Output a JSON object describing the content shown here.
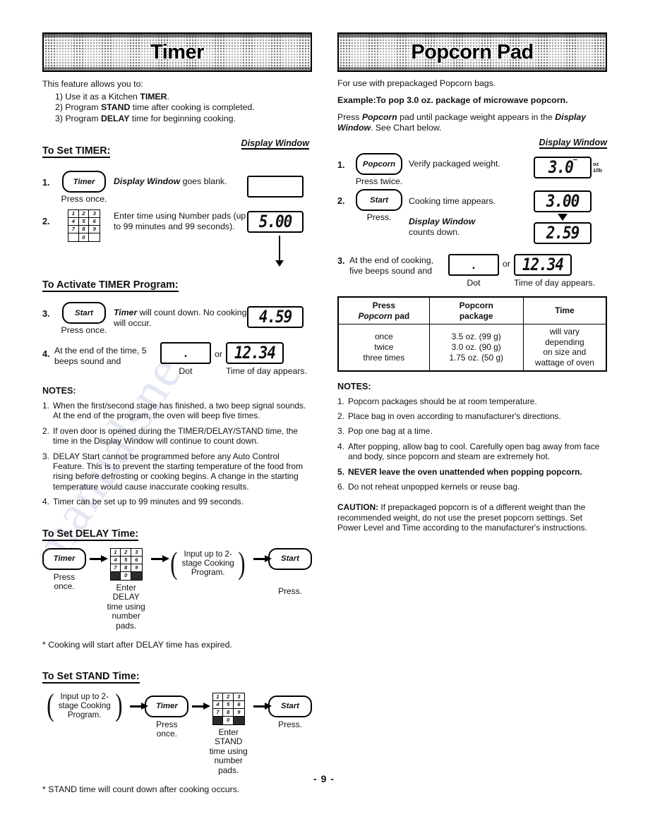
{
  "page": {
    "number": "- 9 -",
    "watermark": "manualsnet"
  },
  "left": {
    "banner_title": "Timer",
    "intro": "This feature allows you to:",
    "feature_list": [
      {
        "num": "1)",
        "pre": "Use it as a Kitchen ",
        "bold": "TIMER",
        "post": "."
      },
      {
        "num": "2)",
        "pre": "Program ",
        "bold": "STAND",
        "post": " time after cooking is completed."
      },
      {
        "num": "3)",
        "pre": "Program ",
        "bold": "DELAY",
        "post": " time for beginning cooking."
      }
    ],
    "section_set_timer": "To Set TIMER:",
    "display_window_label": "Display Window",
    "step1": {
      "num": "1.",
      "key_label": "Timer",
      "caption": "Press once.",
      "text_bold": "Display Window",
      "text_rest": " goes blank.",
      "lcd": ""
    },
    "step2": {
      "num": "2.",
      "keypad": [
        "1",
        "2",
        "3",
        "4",
        "5",
        "6",
        "7",
        "8",
        "9",
        "",
        "0",
        ""
      ],
      "text": "Enter time using Number pads (up to 99 minutes and 99 seconds).",
      "lcd": "5.00"
    },
    "section_activate": "To Activate TIMER Program:",
    "step3": {
      "num": "3.",
      "key_label": "Start",
      "caption": "Press once.",
      "text_bold": "Timer",
      "text_rest": " will count down. No cooking will occur.",
      "lcd": "4.59"
    },
    "step4": {
      "num": "4.",
      "text": "At the end of the time, 5 beeps sound and",
      "dot_caption": "Dot",
      "or": "or",
      "lcd": "12.34",
      "time_caption": "Time of day appears."
    },
    "notes_heading": "NOTES:",
    "notes": [
      {
        "n": "1.",
        "t": "When the first/second stage has finished, a two beep signal sounds.  At the end of the program, the oven will beep five times."
      },
      {
        "n": "2.",
        "t": "If oven door is opened during the TIMER/DELAY/STAND time, the time in the Display Window will continue to count down."
      },
      {
        "n": "3.",
        "t": "DELAY Start cannot be programmed before any Auto Control Feature.  This is to prevent the starting temperature of the food from rising before defrosting or cooking begins.  A change in the starting temperature would cause inaccurate cooking results."
      },
      {
        "n": "4.",
        "t": "Timer can be set up to 99 minutes and 99 seconds."
      }
    ],
    "section_delay": "To Set DELAY Time:",
    "delay_flow": {
      "key1": "Timer",
      "cap1": "Press once.",
      "keypad": [
        "1",
        "2",
        "3",
        "4",
        "5",
        "6",
        "7",
        "8",
        "9",
        "",
        "0",
        ""
      ],
      "cap2": "Enter DELAY time using number pads.",
      "paren_text": "Input up to 2-stage Cooking Program.",
      "key2": "Start",
      "cap3": "Press."
    },
    "delay_note": "* Cooking will start after DELAY time has expired.",
    "section_stand": "To Set STAND Time:",
    "stand_flow": {
      "paren_text": "Input up to 2-stage Cooking Program.",
      "key1": "Timer",
      "cap1": "Press once.",
      "keypad": [
        "1",
        "2",
        "3",
        "4",
        "5",
        "6",
        "7",
        "8",
        "9",
        "",
        "0",
        ""
      ],
      "cap2": "Enter STAND time using number pads.",
      "key2": "Start",
      "cap3": "Press."
    },
    "stand_note": "* STAND time will count down after cooking occurs."
  },
  "right": {
    "banner_title": "Popcorn Pad",
    "line1": "For use with prepackaged Popcorn bags.",
    "example_label": "Example:",
    "example_text": "To pop 3.0 oz. package of microwave popcorn.",
    "press_line": {
      "a": "Press ",
      "b": "Popcorn",
      "c": " pad until package weight appears in the ",
      "d": "Display Window",
      "e": ".  See Chart below."
    },
    "display_window_label": "Display Window",
    "step1": {
      "num": "1.",
      "key_label": "Popcorn",
      "caption": "Press twice.",
      "text": "Verify packaged weight.",
      "lcd": "3.0",
      "unit_top": "oz",
      "unit_bottom": "1/lb"
    },
    "step2": {
      "num": "2.",
      "key_label": "Start",
      "caption": "Press.",
      "text1": "Cooking time appears.",
      "text2_bold": "Display Window",
      "text2_rest": " counts down.",
      "lcd_top": "3.00",
      "lcd_bottom": "2.59"
    },
    "step3": {
      "num": "3.",
      "text": "At the end of cooking, five beeps sound and",
      "dot_caption": "Dot",
      "or": "or",
      "lcd": "12.34",
      "time_caption": "Time of day appears."
    },
    "table": {
      "headers": [
        "Press Popcorn pad",
        "Popcorn package",
        "Time"
      ],
      "header_col1_line1": "Press",
      "header_col1_line2_italic": "Popcorn",
      "header_col1_line2_rest": " pad",
      "header_col2_line1": "Popcorn",
      "header_col2_line2": "package",
      "header_col3": "Time",
      "col1": [
        "once",
        "twice",
        "three times"
      ],
      "col2": [
        "3.5 oz. (99 g)",
        "3.0 oz. (90 g)",
        "1.75 oz. (50 g)"
      ],
      "col3": [
        "will vary",
        "depending",
        "on size and",
        "wattage of oven"
      ]
    },
    "notes_heading": "NOTES:",
    "notes": [
      {
        "n": "1.",
        "t": "Popcorn packages should be at room temperature."
      },
      {
        "n": "2.",
        "t": "Place bag in oven according to manufacturer's directions."
      },
      {
        "n": "3.",
        "t": "Pop one bag at a time."
      },
      {
        "n": "4.",
        "t": "After popping, allow bag to cool.  Carefully open bag away from face and body, since popcorn and steam are extremely hot."
      },
      {
        "n": "5.",
        "t": "NEVER leave the oven unattended when popping popcorn."
      },
      {
        "n": "6.",
        "t": "Do not reheat unpopped kernels or reuse bag."
      }
    ],
    "caution_label": "CAUTION:",
    "caution_text": " If prepackaged popcorn is of a different weight than the recommended weight, do not use the preset popcorn settings.  Set Power Level and Time according to the manufacturer's instructions."
  }
}
